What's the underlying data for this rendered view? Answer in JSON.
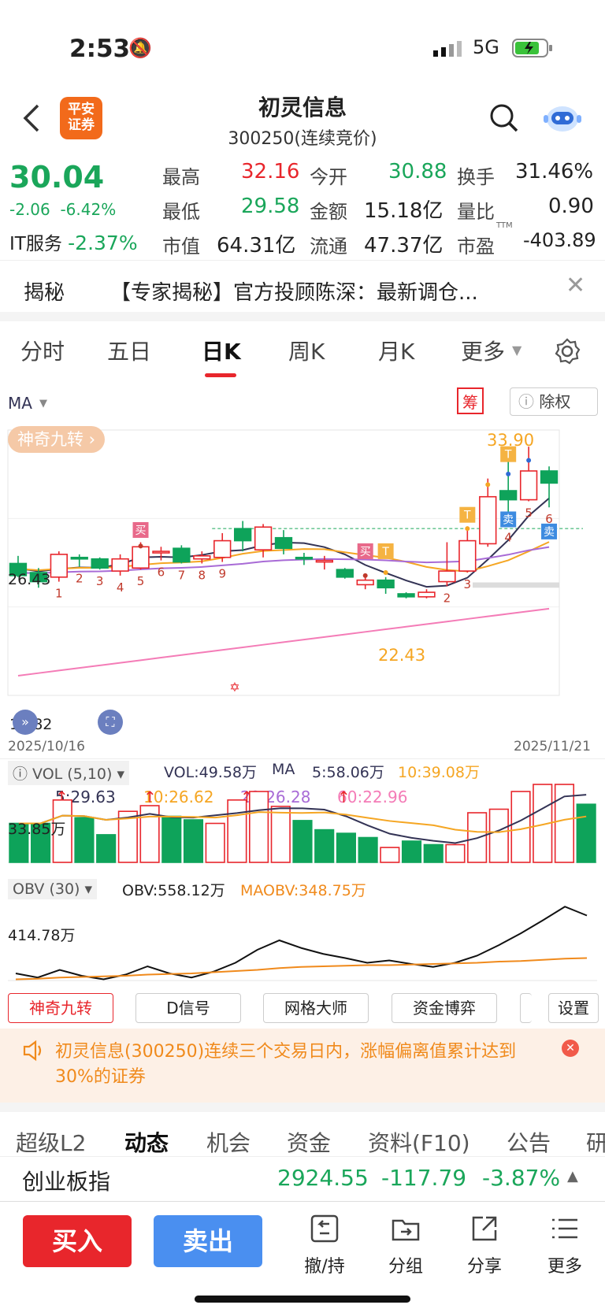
{
  "status_bar": {
    "time": "2:53",
    "network": "5G"
  },
  "header": {
    "title": "初灵信息",
    "subtitle": "300250(连续竞价)",
    "broker_logo": "平安\n证券"
  },
  "quote": {
    "price": "30.04",
    "change": "-2.06",
    "change_pct": "-6.42%",
    "sector": "IT服务",
    "sector_pct": "-2.37%",
    "rows": [
      [
        {
          "label": "最高",
          "value": "32.16",
          "color": "red"
        },
        {
          "label": "今开",
          "value": "30.88",
          "color": "green"
        },
        {
          "label": "换手",
          "value": "31.46%",
          "color": "black"
        }
      ],
      [
        {
          "label": "最低",
          "value": "29.58",
          "color": "green"
        },
        {
          "label": "金额",
          "value": "15.18亿",
          "color": "black"
        },
        {
          "label": "量比",
          "value": "0.90",
          "color": "black"
        }
      ],
      [
        {
          "label": "市值",
          "value": "64.31亿",
          "color": "black"
        },
        {
          "label": "流通",
          "value": "47.37亿",
          "color": "black"
        },
        {
          "label": "市盈",
          "value": "-403.89",
          "color": "black",
          "sup": "TTM"
        }
      ]
    ]
  },
  "banner": {
    "tag": "揭秘",
    "text": "【专家揭秘】官方投顾陈深：最新调仓..."
  },
  "period_tabs": {
    "items": [
      "分时",
      "五日",
      "日K",
      "周K",
      "月K",
      "更多"
    ],
    "active": "日K"
  },
  "ma_legend": {
    "label": "MA",
    "ma5": "5:29.63",
    "ma10": "10:26.62",
    "ma20": "20:26.28",
    "ma60": "60:22.96",
    "chip_btn": "筹",
    "exright_btn": "除权"
  },
  "kline": {
    "badge": "神奇九转",
    "y_labels": {
      "top": "33.90",
      "mid": "26.43",
      "bottom": "18.82",
      "low": "22.43"
    },
    "start_date": "2025/10/16",
    "end_date": "2025/11/21",
    "signals": {
      "buy": "买",
      "sell": "卖",
      "t": "T"
    },
    "seq_numbers": [
      "1",
      "2",
      "3",
      "4",
      "5",
      "6",
      "7",
      "8",
      "9",
      "2",
      "3",
      "4",
      "5",
      "6"
    ],
    "colors": {
      "up": "#e8262c",
      "down": "#0ea35a",
      "ma5": "#333355",
      "ma10": "#f5a623",
      "ma20": "#a86bd6",
      "ma60": "#f47cb7"
    },
    "candles": [
      {
        "o": 26.2,
        "c": 25.4,
        "h": 26.7,
        "l": 25.3
      },
      {
        "o": 25.6,
        "c": 25.0,
        "h": 25.9,
        "l": 24.6
      },
      {
        "o": 25.3,
        "c": 26.8,
        "h": 27.0,
        "l": 25.0
      },
      {
        "o": 26.6,
        "c": 26.5,
        "h": 26.8,
        "l": 26.0
      },
      {
        "o": 26.5,
        "c": 25.9,
        "h": 26.6,
        "l": 25.8
      },
      {
        "o": 25.7,
        "c": 26.5,
        "h": 26.8,
        "l": 25.4
      },
      {
        "o": 25.9,
        "c": 27.3,
        "h": 27.6,
        "l": 25.8
      },
      {
        "o": 27.0,
        "c": 27.0,
        "h": 27.3,
        "l": 26.4
      },
      {
        "o": 27.2,
        "c": 26.3,
        "h": 27.4,
        "l": 26.2
      },
      {
        "o": 26.5,
        "c": 26.7,
        "h": 27.0,
        "l": 26.2
      },
      {
        "o": 26.6,
        "c": 27.7,
        "h": 28.2,
        "l": 26.3
      },
      {
        "o": 28.5,
        "c": 27.7,
        "h": 29.0,
        "l": 27.0
      },
      {
        "o": 27.1,
        "c": 28.6,
        "h": 28.8,
        "l": 26.6
      },
      {
        "o": 27.9,
        "c": 27.2,
        "h": 28.4,
        "l": 26.8
      },
      {
        "o": 26.6,
        "c": 26.5,
        "h": 26.9,
        "l": 26.1
      },
      {
        "o": 26.3,
        "c": 26.4,
        "h": 26.7,
        "l": 25.8
      },
      {
        "o": 25.8,
        "c": 25.3,
        "h": 25.9,
        "l": 25.2
      },
      {
        "o": 24.8,
        "c": 25.1,
        "h": 25.3,
        "l": 24.5
      },
      {
        "o": 25.1,
        "c": 24.6,
        "h": 25.3,
        "l": 24.2
      },
      {
        "o": 24.2,
        "c": 24.0,
        "h": 24.3,
        "l": 23.9
      },
      {
        "o": 24.0,
        "c": 24.3,
        "h": 24.5,
        "l": 23.9
      },
      {
        "o": 25.0,
        "c": 25.7,
        "h": 27.6,
        "l": 24.7
      },
      {
        "o": 25.7,
        "c": 27.7,
        "h": 28.4,
        "l": 25.6
      },
      {
        "o": 27.5,
        "c": 30.6,
        "h": 31.8,
        "l": 27.3
      },
      {
        "o": 31.0,
        "c": 30.4,
        "h": 33.6,
        "l": 28.7
      },
      {
        "o": 30.4,
        "c": 32.3,
        "h": 33.9,
        "l": 30.3
      },
      {
        "o": 32.3,
        "c": 31.5,
        "h": 32.6,
        "l": 29.9
      }
    ]
  },
  "volume": {
    "legend": "VOL (5,10)",
    "vol": "VOL:49.58万",
    "ma_label": "MA",
    "ma5": "5:58.06万",
    "ma10": "10:39.08万",
    "y_label": "33.85万",
    "bars": [
      {
        "v": 0.55,
        "up": false
      },
      {
        "v": 0.55,
        "up": false
      },
      {
        "v": 0.88,
        "up": true
      },
      {
        "v": 0.63,
        "up": false
      },
      {
        "v": 0.39,
        "up": false
      },
      {
        "v": 0.72,
        "up": true
      },
      {
        "v": 0.8,
        "up": true
      },
      {
        "v": 0.65,
        "up": false
      },
      {
        "v": 0.6,
        "up": false
      },
      {
        "v": 0.55,
        "up": true
      },
      {
        "v": 0.88,
        "up": true
      },
      {
        "v": 1.0,
        "up": true
      },
      {
        "v": 0.79,
        "up": true
      },
      {
        "v": 0.59,
        "up": false
      },
      {
        "v": 0.46,
        "up": false
      },
      {
        "v": 0.41,
        "up": false
      },
      {
        "v": 0.35,
        "up": false
      },
      {
        "v": 0.21,
        "up": true
      },
      {
        "v": 0.3,
        "up": false
      },
      {
        "v": 0.25,
        "up": false
      },
      {
        "v": 0.25,
        "up": true
      },
      {
        "v": 0.7,
        "up": true
      },
      {
        "v": 0.75,
        "up": true
      },
      {
        "v": 1.0,
        "up": true
      },
      {
        "v": 1.1,
        "up": true
      },
      {
        "v": 1.1,
        "up": true
      },
      {
        "v": 0.82,
        "up": false
      }
    ]
  },
  "obv": {
    "legend": "OBV (30)",
    "obv": "OBV:558.12万",
    "maobv": "MAOBV:348.75万",
    "y_label": "414.78万",
    "line": [
      0.12,
      0.05,
      0.18,
      0.08,
      0.02,
      0.1,
      0.24,
      0.12,
      0.05,
      0.15,
      0.3,
      0.52,
      0.68,
      0.55,
      0.45,
      0.38,
      0.3,
      0.34,
      0.28,
      0.23,
      0.3,
      0.42,
      0.6,
      0.8,
      1.02,
      1.25,
      1.1
    ],
    "ma": [
      0.02,
      0.03,
      0.05,
      0.06,
      0.07,
      0.08,
      0.1,
      0.11,
      0.12,
      0.14,
      0.16,
      0.18,
      0.21,
      0.23,
      0.24,
      0.25,
      0.26,
      0.26,
      0.27,
      0.28,
      0.29,
      0.3,
      0.32,
      0.33,
      0.35,
      0.37,
      0.38
    ]
  },
  "tool_buttons": [
    "神奇九转",
    "D信号",
    "网格大师",
    "资金博弈",
    "设置"
  ],
  "alert": {
    "text": "初灵信息(300250)连续三个交易日内，涨幅偏离值累计达到30%的证券"
  },
  "feature_tabs": [
    "超级L2",
    "动态",
    "机会",
    "资金",
    "资料(F10)",
    "公告",
    "研"
  ],
  "index_bar": {
    "name": "创业板指",
    "value": "2924.55",
    "change": "-117.79",
    "pct": "-3.87%"
  },
  "bottom_bar": {
    "buy": "买入",
    "sell": "卖出",
    "items": [
      "撤/持",
      "分组",
      "分享",
      "更多"
    ]
  }
}
